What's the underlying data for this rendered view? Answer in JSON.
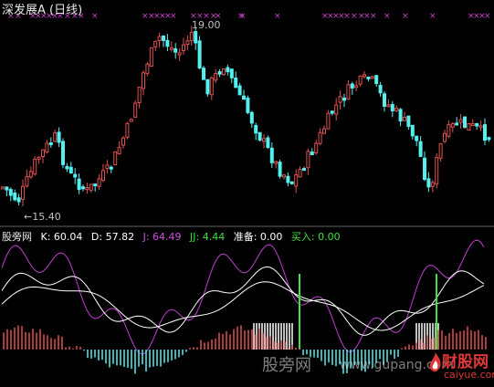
{
  "title": "深发展A (日线)",
  "price_high_label": "19.00",
  "price_low_label": "←15.40",
  "indicator": {
    "name": "股旁网",
    "k": "K: 60.04",
    "d": "D: 57.82",
    "j": "J: 64.49",
    "jj": "JJ: 4.44",
    "prep": "准备: 0.00",
    "buy": "买入: 0.00"
  },
  "watermark_center": "股旁网",
  "watermark_url": "www.gupang.com",
  "logo_main": "财股网",
  "logo_sub": "caiyue.com",
  "colors": {
    "up": "#e05050",
    "down": "#54f0f0",
    "k_line": "#ffffff",
    "d_line": "#ffffff",
    "j_line": "#c040d0",
    "signal": "#40e040",
    "marker": "#d040d0",
    "prep": "#ffffff",
    "buy": "#40e040"
  },
  "chart_data": {
    "type": "candlestick",
    "price_high": 19.0,
    "price_low": 15.4
  }
}
